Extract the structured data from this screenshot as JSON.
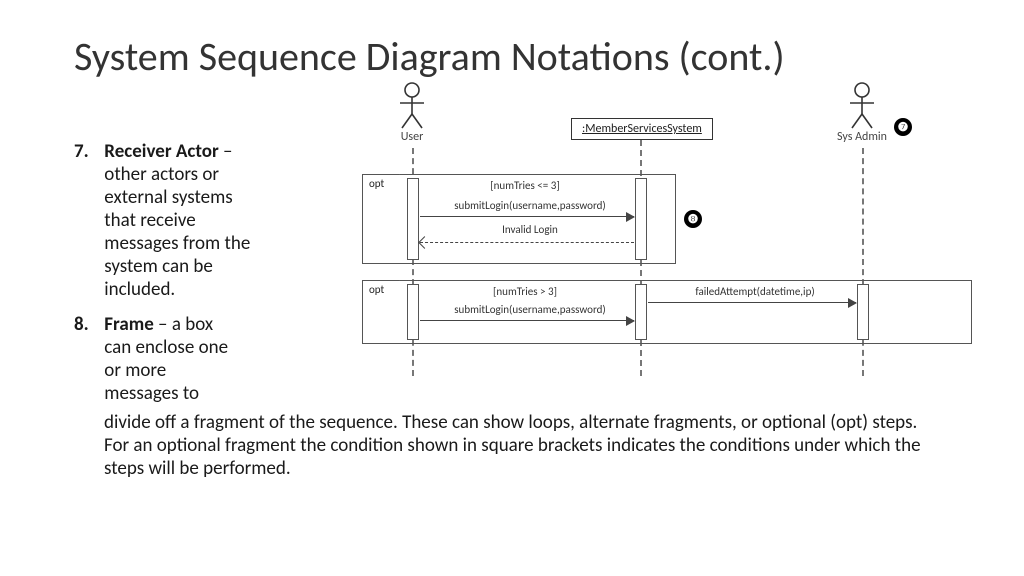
{
  "title": "System Sequence Diagram Notations (cont.)",
  "bullets": {
    "n7": {
      "num": "7.",
      "term": "Receiver Actor",
      "text": " – other actors or external systems that receive messages from the system can be included."
    },
    "n8": {
      "num": "8.",
      "term": "Frame",
      "text_narrow": " – a box can enclose one or more messages to",
      "text_wide": "divide off a fragment of the sequence. These can show loops, alternate fragments, or optional (opt) steps. For an optional fragment the condition shown in square brackets indicates the conditions under which the steps will be performed."
    }
  },
  "diagram": {
    "actors": {
      "user": "User",
      "admin": "Sys Admin"
    },
    "object": ":MemberServicesSystem",
    "frames": {
      "f1": "opt",
      "f2": "opt"
    },
    "guards": {
      "g1": "[numTries <= 3]",
      "g2": "[numTries > 3]"
    },
    "messages": {
      "m1": "submitLogin(username,password)",
      "m2": "Invalid Login",
      "m3": "submitLogin(username,password)",
      "m4": "failedAttempt(datetime,ip)"
    },
    "callouts": {
      "c7": "❼",
      "c8": "❽"
    }
  }
}
